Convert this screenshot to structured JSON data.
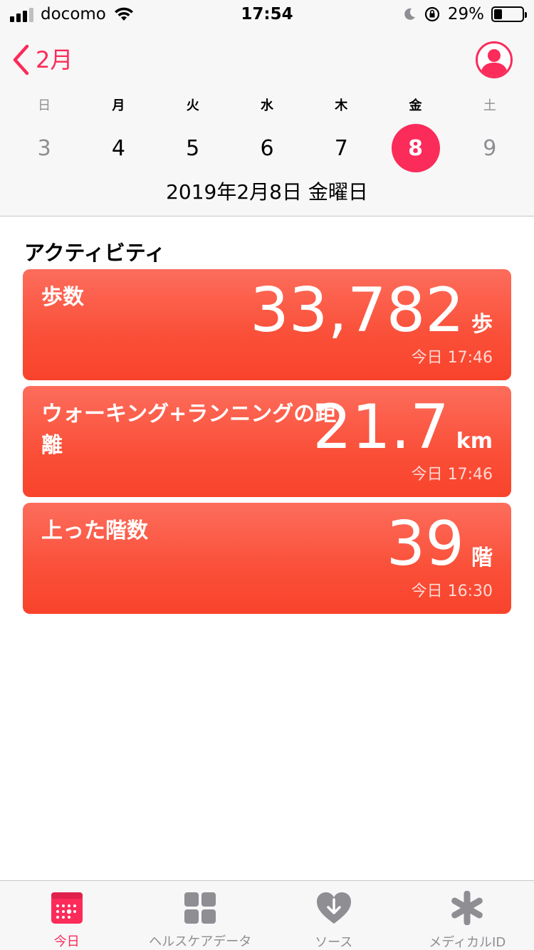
{
  "status_bar": {
    "carrier": "docomo",
    "time": "17:54",
    "battery_percent": "29%",
    "battery_level": 0.29
  },
  "header": {
    "back_label": "2月",
    "weekdays": [
      "日",
      "月",
      "火",
      "水",
      "木",
      "金",
      "土"
    ],
    "dates": [
      "3",
      "4",
      "5",
      "6",
      "7",
      "8",
      "9"
    ],
    "selected_index": 5,
    "full_date": "2019年2月8日 金曜日"
  },
  "activity": {
    "section_title": "アクティビティ",
    "cards": [
      {
        "title": "歩数",
        "value": "33,782",
        "unit": "歩",
        "time": "今日 17:46"
      },
      {
        "title": "ウォーキング+ランニングの距離",
        "value": "21.7",
        "unit": "km",
        "time": "今日 17:46"
      },
      {
        "title": "上った階数",
        "value": "39",
        "unit": "階",
        "time": "今日 16:30"
      }
    ]
  },
  "tabbar": {
    "tabs": [
      {
        "label": "今日",
        "icon": "calendar-icon",
        "active": true
      },
      {
        "label": "ヘルスケアデータ",
        "icon": "grid-icon",
        "active": false
      },
      {
        "label": "ソース",
        "icon": "heart-download-icon",
        "active": false
      },
      {
        "label": "メディカルID",
        "icon": "asterisk-icon",
        "active": false
      }
    ]
  },
  "colors": {
    "accent": "#fb2b5a",
    "card_top": "#fd6d5c",
    "card_bottom": "#f9432c",
    "inactive": "#8e8e93"
  }
}
